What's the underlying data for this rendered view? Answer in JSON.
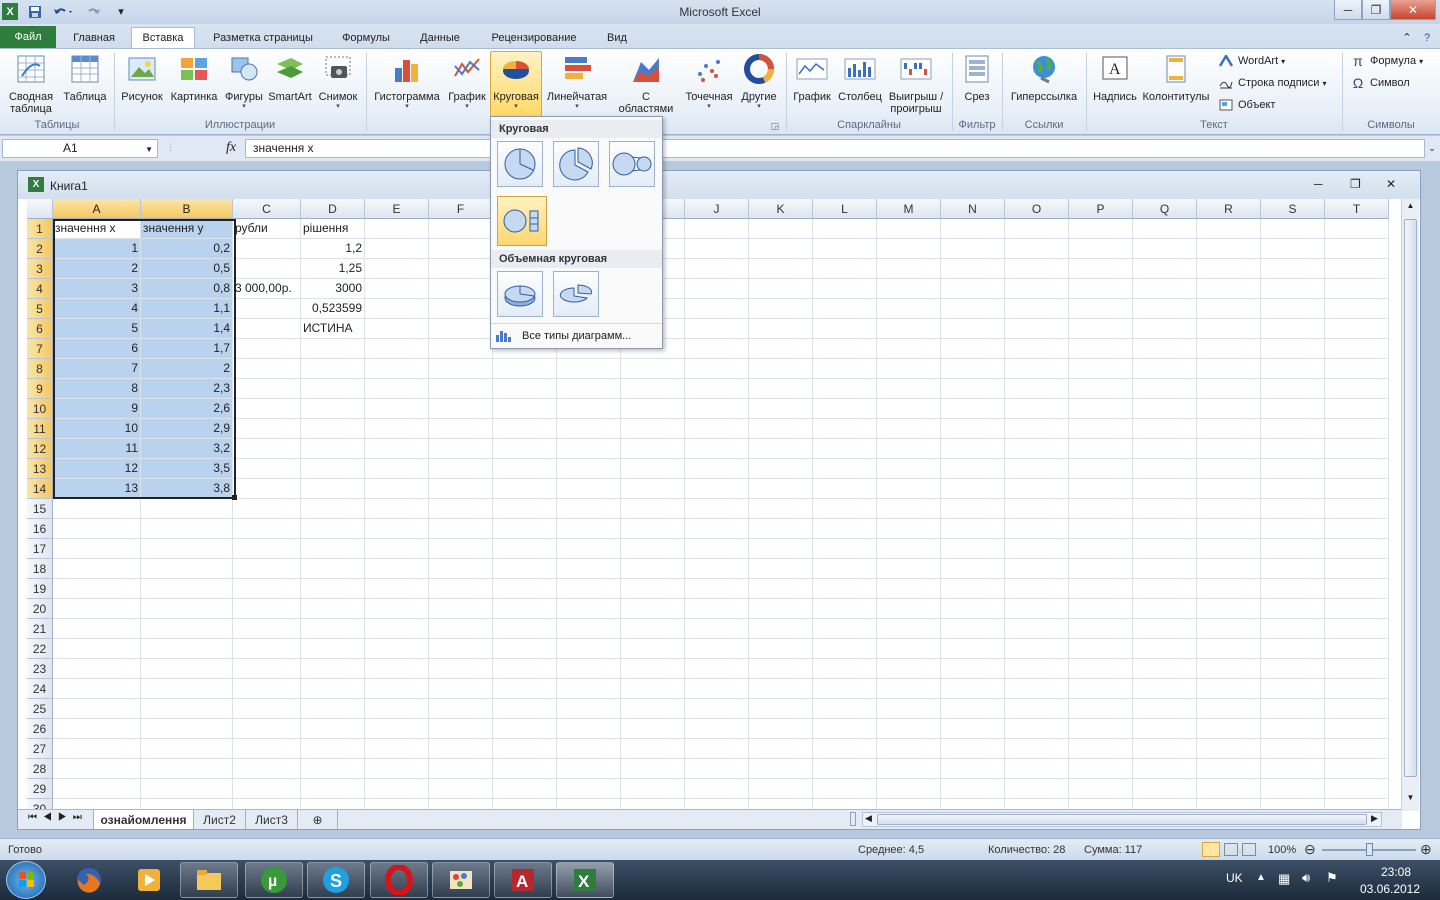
{
  "window": {
    "title": "Microsoft Excel"
  },
  "tabs": {
    "file": "Файл",
    "home": "Главная",
    "insert": "Вставка",
    "layout": "Разметка страницы",
    "formulas": "Формулы",
    "data": "Данные",
    "review": "Рецензирование",
    "view": "Вид"
  },
  "ribbon": {
    "pivot_line1": "Сводная",
    "pivot_line2": "таблица",
    "table": "Таблица",
    "picture": "Рисунок",
    "clipart": "Картинка",
    "shapes": "Фигуры",
    "smartart": "SmartArt",
    "screenshot": "Снимок",
    "histogram": "Гистограмма",
    "line_chart": "График",
    "pie_chart": "Круговая",
    "bar_chart": "Линейчатая",
    "area_line1": "С",
    "area_line2": "областями",
    "scatter": "Точечная",
    "other": "Другие",
    "spark_line": "График",
    "spark_column": "Столбец",
    "spark_winloss_line1": "Выигрыш /",
    "spark_winloss_line2": "проигрыш",
    "slicer": "Срез",
    "hyperlink": "Гиперссылка",
    "textbox": "Надпись",
    "headerfooter": "Колонтитулы",
    "wordart": "WordArt",
    "signature": "Строка подписи",
    "object": "Объект",
    "formula": "Формула",
    "symbol": "Символ",
    "groups": {
      "tables": "Таблицы",
      "illustrations": "Иллюстрации",
      "sparklines": "Спарклайны",
      "filter": "Фильтр",
      "links": "Ссылки",
      "text": "Текст",
      "symbols": "Символы"
    }
  },
  "formula_bar": {
    "name_box": "A1",
    "fx": "fx",
    "content": "значення х"
  },
  "workbook": {
    "title": "Книга1"
  },
  "columns": [
    "A",
    "B",
    "C",
    "D",
    "E",
    "F",
    "G",
    "H",
    "I",
    "J",
    "K",
    "L",
    "M",
    "N",
    "O",
    "P",
    "Q",
    "R",
    "S",
    "T"
  ],
  "rows": [
    [
      "значення х",
      "значення у",
      "рубли",
      "рішення"
    ],
    [
      "1",
      "0,2",
      "",
      "1,2"
    ],
    [
      "2",
      "0,5",
      "",
      "1,25"
    ],
    [
      "3",
      "0,8",
      "3 000,00р.",
      "3000"
    ],
    [
      "4",
      "1,1",
      "",
      "0,523599"
    ],
    [
      "5",
      "1,4",
      "",
      "ИСТИНА"
    ],
    [
      "6",
      "1,7",
      "",
      ""
    ],
    [
      "7",
      "2",
      "",
      ""
    ],
    [
      "8",
      "2,3",
      "",
      ""
    ],
    [
      "9",
      "2,6",
      "",
      ""
    ],
    [
      "10",
      "2,9",
      "",
      ""
    ],
    [
      "11",
      "3,2",
      "",
      ""
    ],
    [
      "12",
      "3,5",
      "",
      ""
    ],
    [
      "13",
      "3,8",
      "",
      ""
    ]
  ],
  "row_count": 30,
  "sheets": {
    "s1": "ознайомлення",
    "s2": "Лист2",
    "s3": "Лист3"
  },
  "dropdown": {
    "section1": "Круговая",
    "section2": "Объемная круговая",
    "all_types": "Все типы диаграмм..."
  },
  "status": {
    "ready": "Готово",
    "average": "Среднее: 4,5",
    "count": "Количество: 28",
    "sum": "Сумма: 117",
    "zoom": "100%"
  },
  "taskbar": {
    "lang": "UK",
    "time": "23:08",
    "date": "03.06.2012"
  },
  "colors": {
    "excel_green": "#2f7d3c",
    "selection": "#b9d3ef",
    "header_selected": "#f5c75f"
  }
}
